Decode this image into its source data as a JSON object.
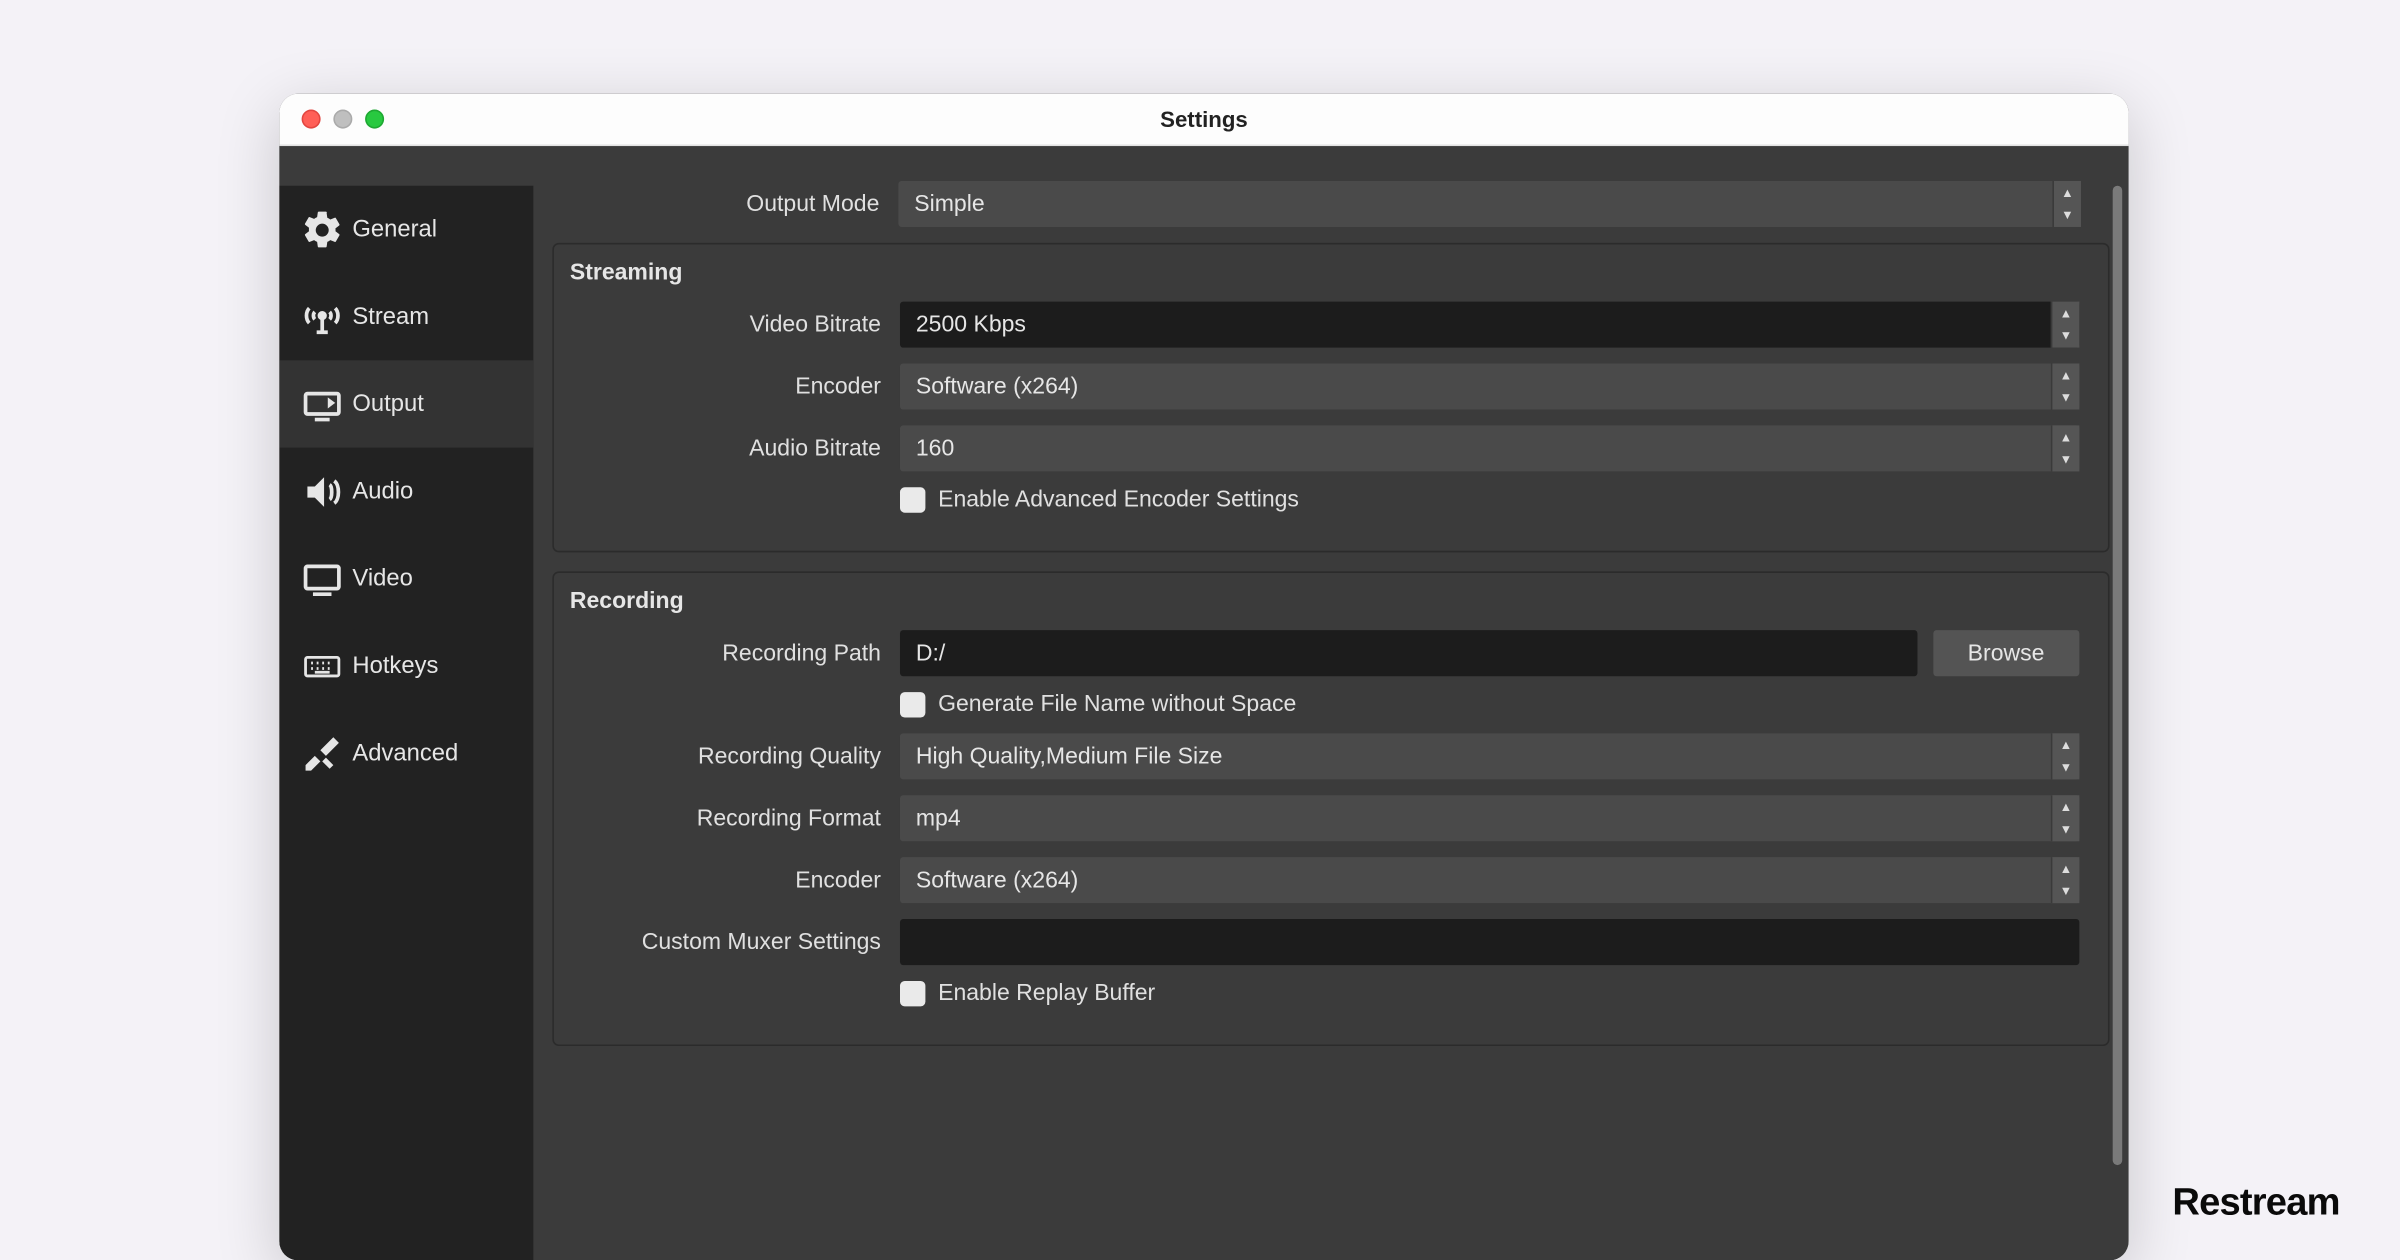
{
  "window": {
    "title": "Settings"
  },
  "sidebar": {
    "items": [
      {
        "label": "General"
      },
      {
        "label": "Stream"
      },
      {
        "label": "Output"
      },
      {
        "label": "Audio"
      },
      {
        "label": "Video"
      },
      {
        "label": "Hotkeys"
      },
      {
        "label": "Advanced"
      }
    ],
    "activeIndex": 2
  },
  "output_mode": {
    "label": "Output Mode",
    "value": "Simple"
  },
  "streaming": {
    "title": "Streaming",
    "video_bitrate": {
      "label": "Video Bitrate",
      "value": "2500 Kbps"
    },
    "encoder": {
      "label": "Encoder",
      "value": "Software (x264)"
    },
    "audio_bitrate": {
      "label": "Audio Bitrate",
      "value": "160"
    },
    "advanced_checkbox": {
      "label": "Enable Advanced Encoder Settings",
      "checked": false
    }
  },
  "recording": {
    "title": "Recording",
    "path": {
      "label": "Recording Path",
      "value": "D:/",
      "browse": "Browse"
    },
    "no_space": {
      "label": "Generate File Name without Space",
      "checked": false
    },
    "quality": {
      "label": "Recording Quality",
      "value": "High Quality,Medium File Size"
    },
    "format": {
      "label": "Recording Format",
      "value": "mp4"
    },
    "encoder": {
      "label": "Encoder",
      "value": "Software (x264)"
    },
    "muxer": {
      "label": "Custom Muxer Settings",
      "value": ""
    },
    "replay": {
      "label": "Enable Replay Buffer",
      "checked": false
    }
  },
  "watermark": "Restream"
}
